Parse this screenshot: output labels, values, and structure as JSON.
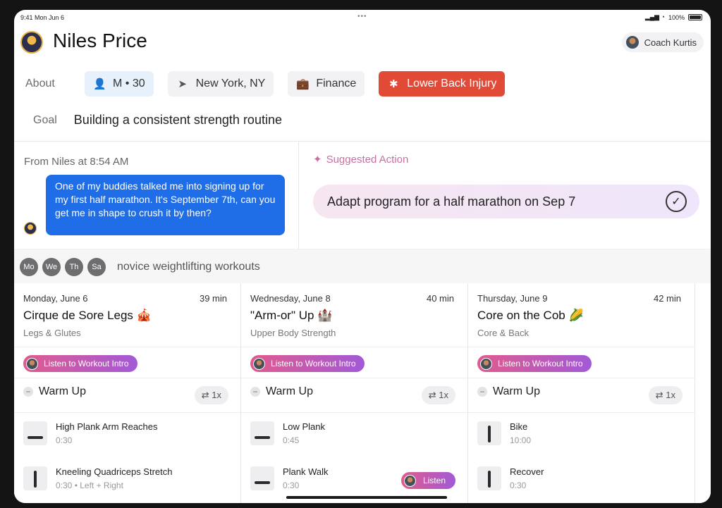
{
  "status_bar": {
    "time": "9:41  Mon Jun 6",
    "dots": "•••",
    "battery": "100%",
    "signal": "▂▄▆ ◔"
  },
  "profile": {
    "name": "Niles Price",
    "coach": "Coach Kurtis"
  },
  "about": {
    "label": "About",
    "chips": [
      {
        "icon": "person-icon",
        "glyph": "👤",
        "text": "M • 30"
      },
      {
        "icon": "location-arrow-icon",
        "glyph": "➤",
        "text": "New York, NY"
      },
      {
        "icon": "briefcase-icon",
        "glyph": "💼",
        "text": "Finance"
      },
      {
        "icon": "asterisk-icon",
        "glyph": "✱",
        "text": "Lower Back Injury"
      }
    ]
  },
  "goal": {
    "label": "Goal",
    "text": "Building a consistent strength routine"
  },
  "message": {
    "from": "From Niles at 8:54 AM",
    "text": "One of my buddies talked me into signing up for my first half marathon. It's September 7th, can you get me in shape to crush it by then?"
  },
  "suggestion": {
    "label": "Suggested Action",
    "action": "Adapt program for a half marathon on Sep 7",
    "check": "✓"
  },
  "program": {
    "days": [
      "Mo",
      "We",
      "Th",
      "Sa"
    ],
    "label": "novice weightlifting workouts",
    "cards": [
      {
        "date": "Monday, June 6",
        "duration": "39 min",
        "title": "Cirque de Sore Legs 🎪",
        "category": "Legs & Glutes",
        "intro": "Listen to Workout Intro",
        "section": "Warm Up",
        "repeat": "⇄ 1x",
        "exercises": [
          {
            "name": "High Plank Arm Reaches",
            "detail": "0:30"
          },
          {
            "name": "Kneeling Quadriceps Stretch",
            "detail": "0:30 • Left + Right"
          }
        ]
      },
      {
        "date": "Wednesday, June 8",
        "duration": "40 min",
        "title": "\"Arm-or\" Up 🏰",
        "category": "Upper Body Strength",
        "intro": "Listen to Workout Intro",
        "section": "Warm Up",
        "repeat": "⇄ 1x",
        "exercises": [
          {
            "name": "Low Plank",
            "detail": "0:45"
          },
          {
            "name": "Plank Walk",
            "detail": "0:30"
          }
        ],
        "listen": "Listen"
      },
      {
        "date": "Thursday, June 9",
        "duration": "42 min",
        "title": "Core on the Cob 🌽",
        "category": "Core & Back",
        "intro": "Listen to Workout Intro",
        "section": "Warm Up",
        "repeat": "⇄ 1x",
        "exercises": [
          {
            "name": "Bike",
            "detail": "10:00"
          },
          {
            "name": "Recover",
            "detail": "0:30"
          }
        ]
      }
    ]
  }
}
